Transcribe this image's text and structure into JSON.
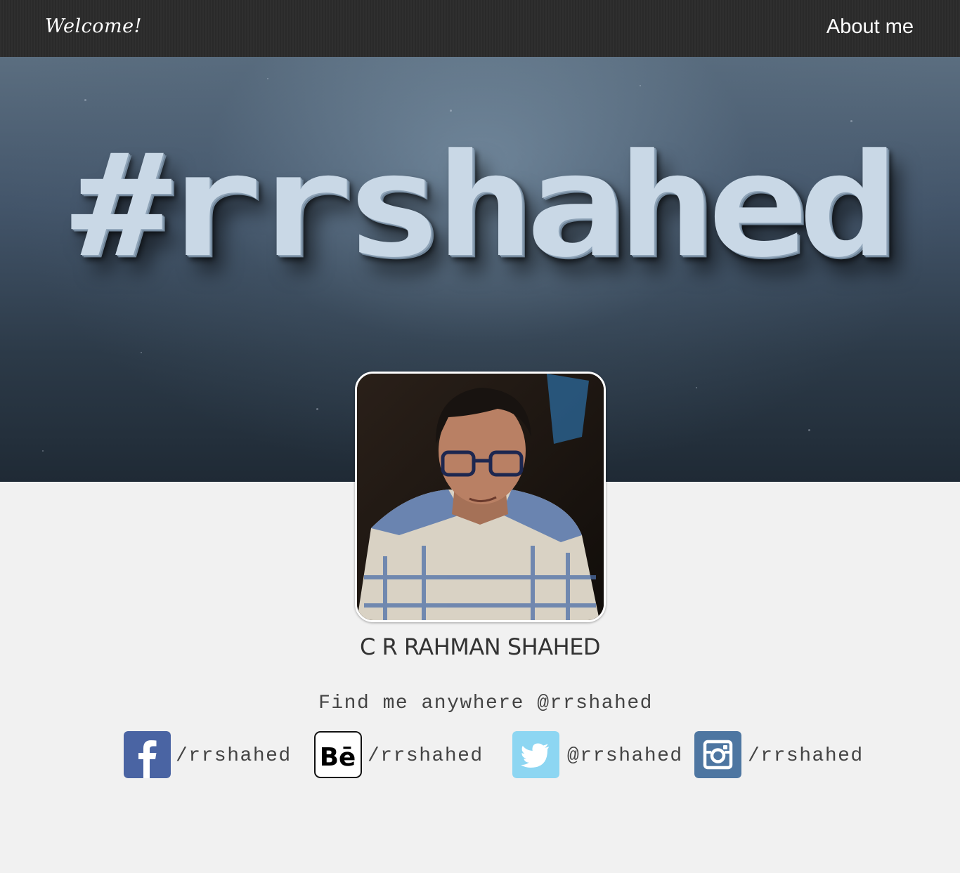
{
  "nav": {
    "welcome": "Welcome!",
    "about": "About me"
  },
  "hero": {
    "title": "#rrshahed"
  },
  "profile": {
    "name": "C R RAHMAN SHAHED",
    "tagline": "Find me anywhere @rrshahed"
  },
  "social": [
    {
      "network": "facebook",
      "icon": "facebook-icon",
      "label": "/rrshahed",
      "color": "#4a64a3"
    },
    {
      "network": "behance",
      "icon": "behance-icon",
      "label": "/rrshahed",
      "color": "#000000"
    },
    {
      "network": "twitter",
      "icon": "twitter-icon",
      "label": "@rrshahed",
      "color": "#8dd6f2"
    },
    {
      "network": "instagram",
      "icon": "instagram-icon",
      "label": "/rrshahed",
      "color": "#4e76a1"
    }
  ]
}
